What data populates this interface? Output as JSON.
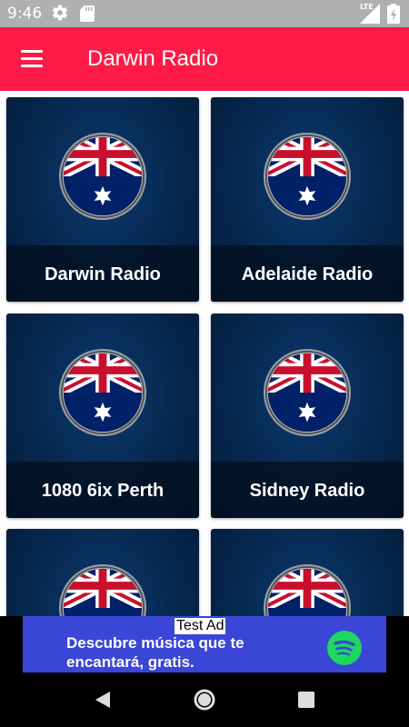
{
  "status_bar": {
    "time": "9:46",
    "icons": [
      "settings-icon",
      "sd-card-icon",
      "lte-signal-icon",
      "battery-charging-icon"
    ],
    "network_label": "LTE"
  },
  "app_bar": {
    "title": "Darwin Radio",
    "menu_icon": "hamburger-menu-icon",
    "color": "#ff1a47"
  },
  "stations": [
    {
      "name": "Darwin Radio",
      "icon": "australia-flag-icon"
    },
    {
      "name": "Adelaide Radio",
      "icon": "australia-flag-icon"
    },
    {
      "name": "1080 6ix Perth",
      "icon": "australia-flag-icon"
    },
    {
      "name": "Sidney Radio",
      "icon": "australia-flag-icon"
    },
    {
      "name": "",
      "icon": "australia-flag-icon"
    },
    {
      "name": "",
      "icon": "australia-flag-icon"
    }
  ],
  "ad": {
    "badge": "Test Ad",
    "text": "Descubre música que te encantará, gratis.",
    "icon": "spotify-icon",
    "color": "#3a46d6"
  },
  "nav_bar": {
    "buttons": [
      "back-icon",
      "home-icon",
      "recents-icon"
    ]
  }
}
